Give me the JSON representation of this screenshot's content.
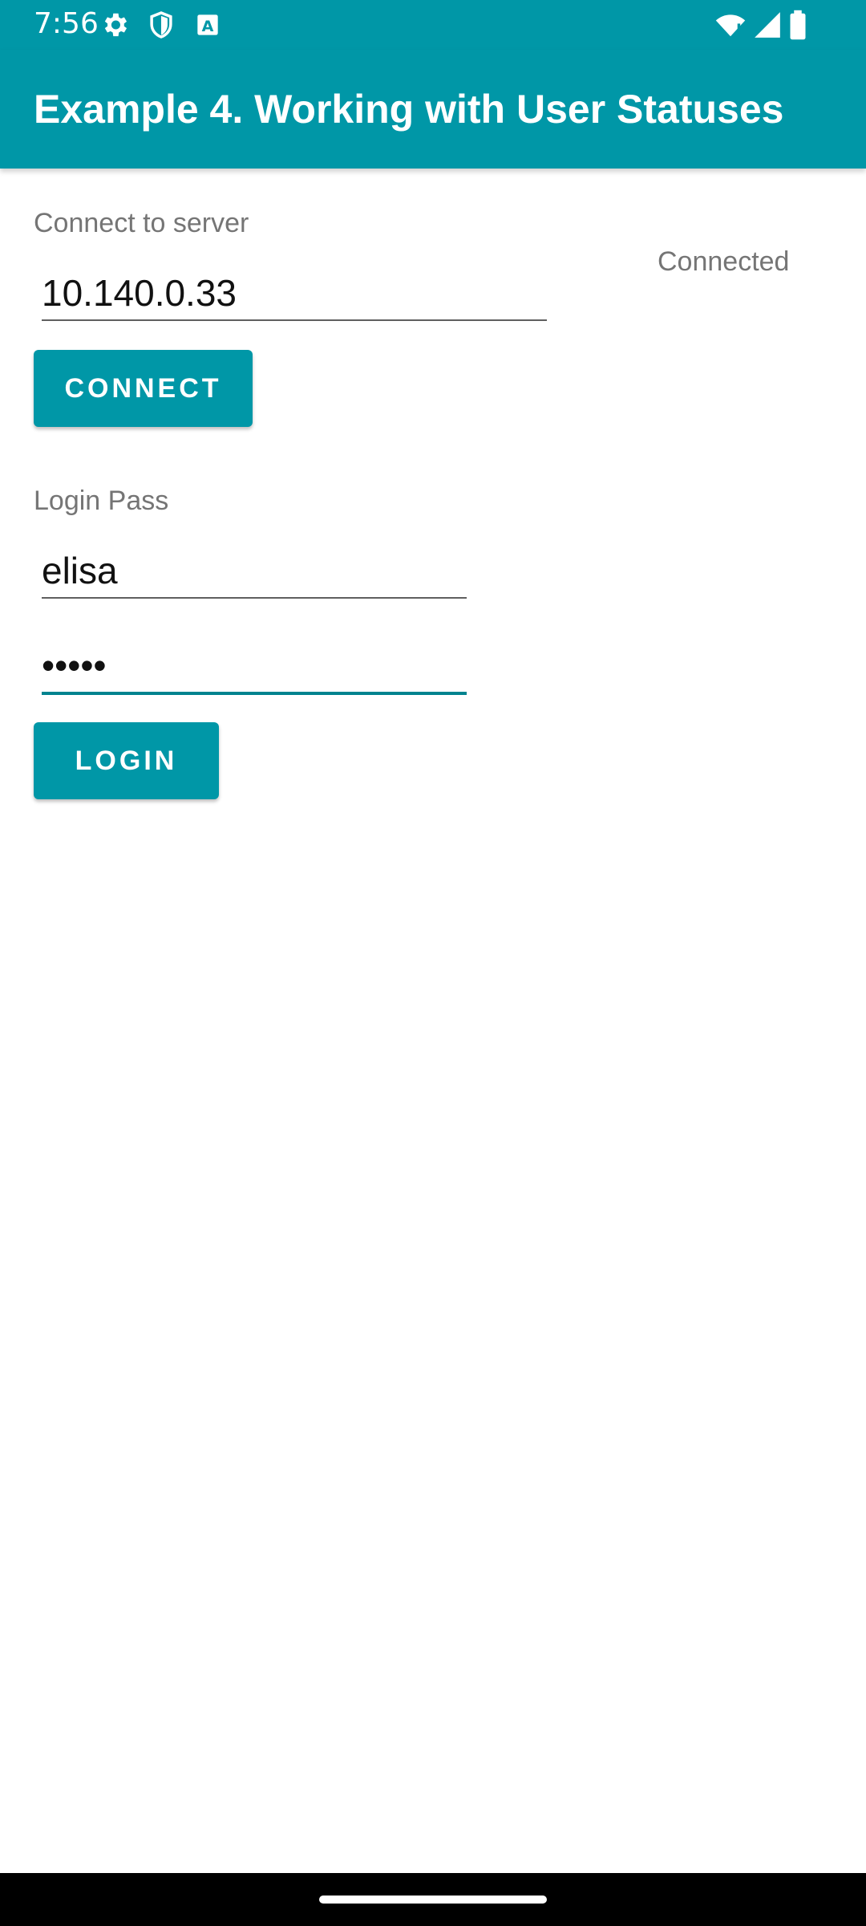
{
  "status_bar": {
    "time": "7:56",
    "icons": [
      "gear-icon",
      "shield-icon",
      "a-icon",
      "wifi-icon",
      "signal-icon",
      "battery-icon"
    ]
  },
  "app_bar": {
    "title": "Example 4. Working with User Statuses"
  },
  "connect": {
    "label": "Connect to server",
    "server_value": "10.140.0.33",
    "button_label": "CONNECT",
    "status": "Connected"
  },
  "login": {
    "label": "Login Pass",
    "username_value": "elisa",
    "password_value": "•••••",
    "button_label": "LOGIN"
  },
  "colors": {
    "accent": "#0097a7",
    "accent_dark": "#00838f",
    "label_gray": "#757575"
  }
}
